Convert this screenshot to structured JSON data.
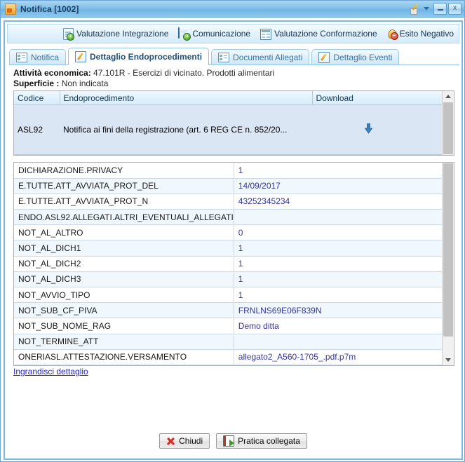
{
  "window": {
    "title": "Notifica [1002]",
    "icon": "window-app-icon",
    "controls": {
      "pencil_icon": "pencil-icon",
      "caret_icon": "chevron-down-icon",
      "minimize_label": "",
      "close_label": "x"
    }
  },
  "toolbar": {
    "items": [
      {
        "label": "Valutazione Integrazione",
        "icon": "page-add-icon"
      },
      {
        "label": "Comunicazione",
        "icon": "mail-add-icon"
      },
      {
        "label": "Valutazione Conformazione",
        "icon": "grid-icon"
      },
      {
        "label": "Esito Negativo",
        "icon": "bell-minus-icon"
      }
    ]
  },
  "tabs": [
    {
      "label": "Notifica",
      "icon": "list-icon",
      "active": false
    },
    {
      "label": "Dettaglio Endoprocedimenti",
      "icon": "edit-doc-icon",
      "active": true
    },
    {
      "label": "Documenti Allegati",
      "icon": "list-icon",
      "active": false
    },
    {
      "label": "Dettaglio Eventi",
      "icon": "edit-doc-icon",
      "active": false
    }
  ],
  "info": {
    "attivita_label": "Attività economica:",
    "attivita_value": "47.101R - Esercizi di vicinato. Prodotti alimentari",
    "superficie_label": "Superficie :",
    "superficie_value": "Non indicata"
  },
  "endo_grid": {
    "columns": [
      "Codice",
      "Endoprocedimento",
      "Download"
    ],
    "rows": [
      {
        "codice": "ASL92",
        "endoprocedimento": "Notifica ai fini della registrazione (art. 6 REG CE n. 852/20...",
        "download_icon": "download-arrow-icon"
      }
    ]
  },
  "detail_grid": {
    "rows": [
      {
        "key": "DICHIARAZIONE.PRIVACY",
        "value": "1"
      },
      {
        "key": "E.TUTTE.ATT_AVVIATA_PROT_DEL",
        "value": "14/09/2017"
      },
      {
        "key": "E.TUTTE.ATT_AVVIATA_PROT_N",
        "value": "43252345234"
      },
      {
        "key": "ENDO.ASL92.ALLEGATI.ALTRI_EVENTUALI_ALLEGATI",
        "value": ""
      },
      {
        "key": "NOT_AL_ALTRO",
        "value": "0"
      },
      {
        "key": "NOT_AL_DICH1",
        "value": "1"
      },
      {
        "key": "NOT_AL_DICH2",
        "value": "1"
      },
      {
        "key": "NOT_AL_DICH3",
        "value": "1"
      },
      {
        "key": "NOT_AVVIO_TIPO",
        "value": "1"
      },
      {
        "key": "NOT_SUB_CF_PIVA",
        "value": "FRNLNS69E06F839N"
      },
      {
        "key": "NOT_SUB_NOME_RAG",
        "value": "Demo ditta"
      },
      {
        "key": "NOT_TERMINE_ATT",
        "value": ""
      },
      {
        "key": "ONERIASL.ATTESTAZIONE.VERSAMENTO",
        "value": "allegato2_A560-1705_.pdf.p7m"
      }
    ]
  },
  "detail_link": {
    "label": "Ingrandisci dettaglio"
  },
  "footer": {
    "close_button": {
      "label": "Chiudi",
      "icon": "red-x-icon"
    },
    "linked_button": {
      "label": "Pratica collegata",
      "icon": "book-arrow-icon"
    }
  },
  "colors": {
    "titlebar": "#85c2ea",
    "frame_border": "#7cb7de",
    "tab_active_text": "#1f4f78",
    "value_text": "#33349c",
    "link": "#2525c8",
    "row_selected": "#dbe6f5"
  }
}
